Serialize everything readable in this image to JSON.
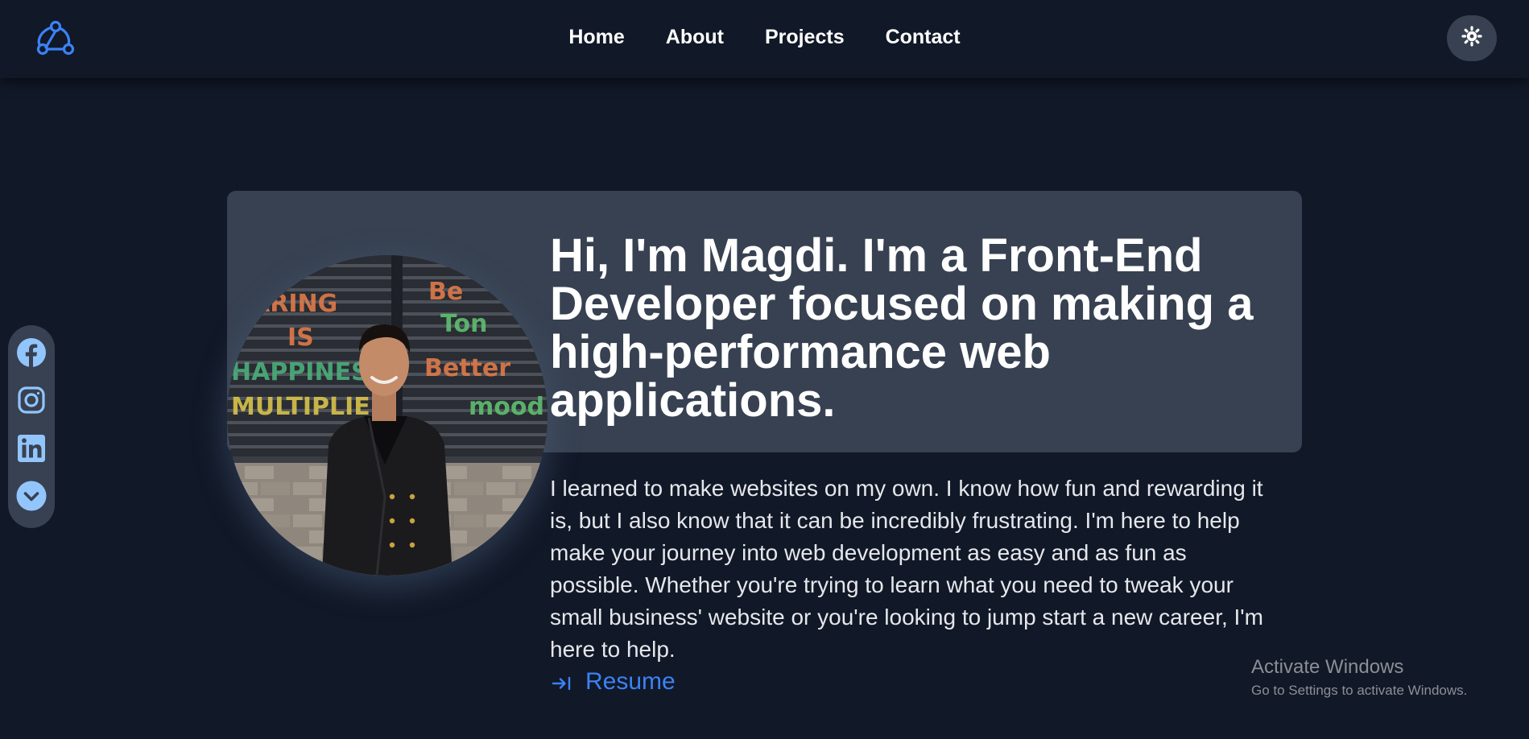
{
  "nav": {
    "logo_icon": "webhook-icon",
    "links": [
      "Home",
      "About",
      "Projects",
      "Contact"
    ],
    "theme_toggle_icon": "sun-icon"
  },
  "social": {
    "icons": [
      "facebook-icon",
      "instagram-icon",
      "linkedin-icon",
      "chevron-down-circle-icon"
    ]
  },
  "hero": {
    "headline": "Hi, I'm Magdi. I'm a Front-End Developer focused on making a high-performance web applications.",
    "bio": "I learned to make websites on my own. I know how fun and rewarding it is, but I also know that it can be incredibly frustrating. I'm here to help make your journey into web development as easy and as fun as possible. Whether you're trying to learn what you need to tweak your small business' website or you're looking to jump start a new career, I'm here to help.",
    "resume_label": "Resume",
    "resume_icon": "arrow-right-to-line-icon"
  },
  "watermark": {
    "title": "Activate Windows",
    "subtitle": "Go to Settings to activate Windows."
  },
  "colors": {
    "background": "#111827",
    "card": "#374151",
    "accent": "#3b82f6",
    "text": "#ffffff"
  }
}
